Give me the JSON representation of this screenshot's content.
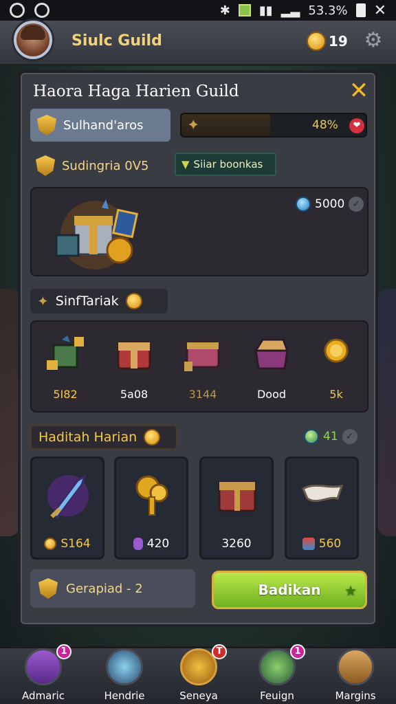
{
  "status_bar": {
    "battery": "53.3%"
  },
  "header": {
    "guild_name": "Siulc Guild",
    "coins": "19"
  },
  "panel": {
    "title": "Haora Haga Harien Guild",
    "badge_label": "Sulhand'aros",
    "progress_text": "48%",
    "progress_value": 0.48,
    "row2_label": "Sudingria 0V5",
    "row2_button": "Siiar boonkas",
    "chest_price": "5000",
    "shop_tab_label": "SinfTariak",
    "shop_items": [
      {
        "label": "5I82",
        "color": "#f5c74a",
        "icon": "gem-block-icon"
      },
      {
        "label": "5a08",
        "color": "#ffffff",
        "icon": "red-chest-icon"
      },
      {
        "label": "3144",
        "color": "#b89a4a",
        "icon": "pink-chest-icon"
      },
      {
        "label": "Dood",
        "color": "#ffffff",
        "icon": "open-chest-icon"
      },
      {
        "label": "5k",
        "color": "#f5c74a",
        "icon": "coin-icon"
      }
    ],
    "daily_tab_label": "Haditah Harian",
    "daily_count": "41",
    "daily_cards": [
      {
        "value": "S164",
        "icon": "glowing-sword-icon",
        "cur": "coin-currency-icon",
        "color": "#f5c74a"
      },
      {
        "value": "420",
        "icon": "golden-key-icon",
        "cur": "potion-currency-icon",
        "color": "#ffffff"
      },
      {
        "value": "3260",
        "icon": "red-chest-icon",
        "cur": "",
        "color": "#ffffff"
      },
      {
        "value": "560",
        "icon": "white-scarf-icon",
        "cur": "crystal-currency-icon",
        "color": "#f5c74a"
      }
    ],
    "bottom_badge_label": "Gerapiad - 2",
    "claim_button": "Badikan"
  },
  "bottom_nav": [
    {
      "label": "Admaric",
      "badge": "1",
      "icon": "purple-box-icon"
    },
    {
      "label": "Hendrie",
      "badge": "",
      "icon": "crystal-hand-icon"
    },
    {
      "label": "Seneya",
      "badge": "T",
      "icon": "golden-fist-icon"
    },
    {
      "label": "Feuign",
      "badge": "1",
      "icon": "gem-leaf-icon"
    },
    {
      "label": "Margins",
      "badge": "",
      "icon": "wooden-crate-icon"
    }
  ],
  "colors": {
    "accent_gold": "#f5c74a",
    "claim_green": "#8fd03a",
    "panel_bg": "#3a3c44"
  }
}
